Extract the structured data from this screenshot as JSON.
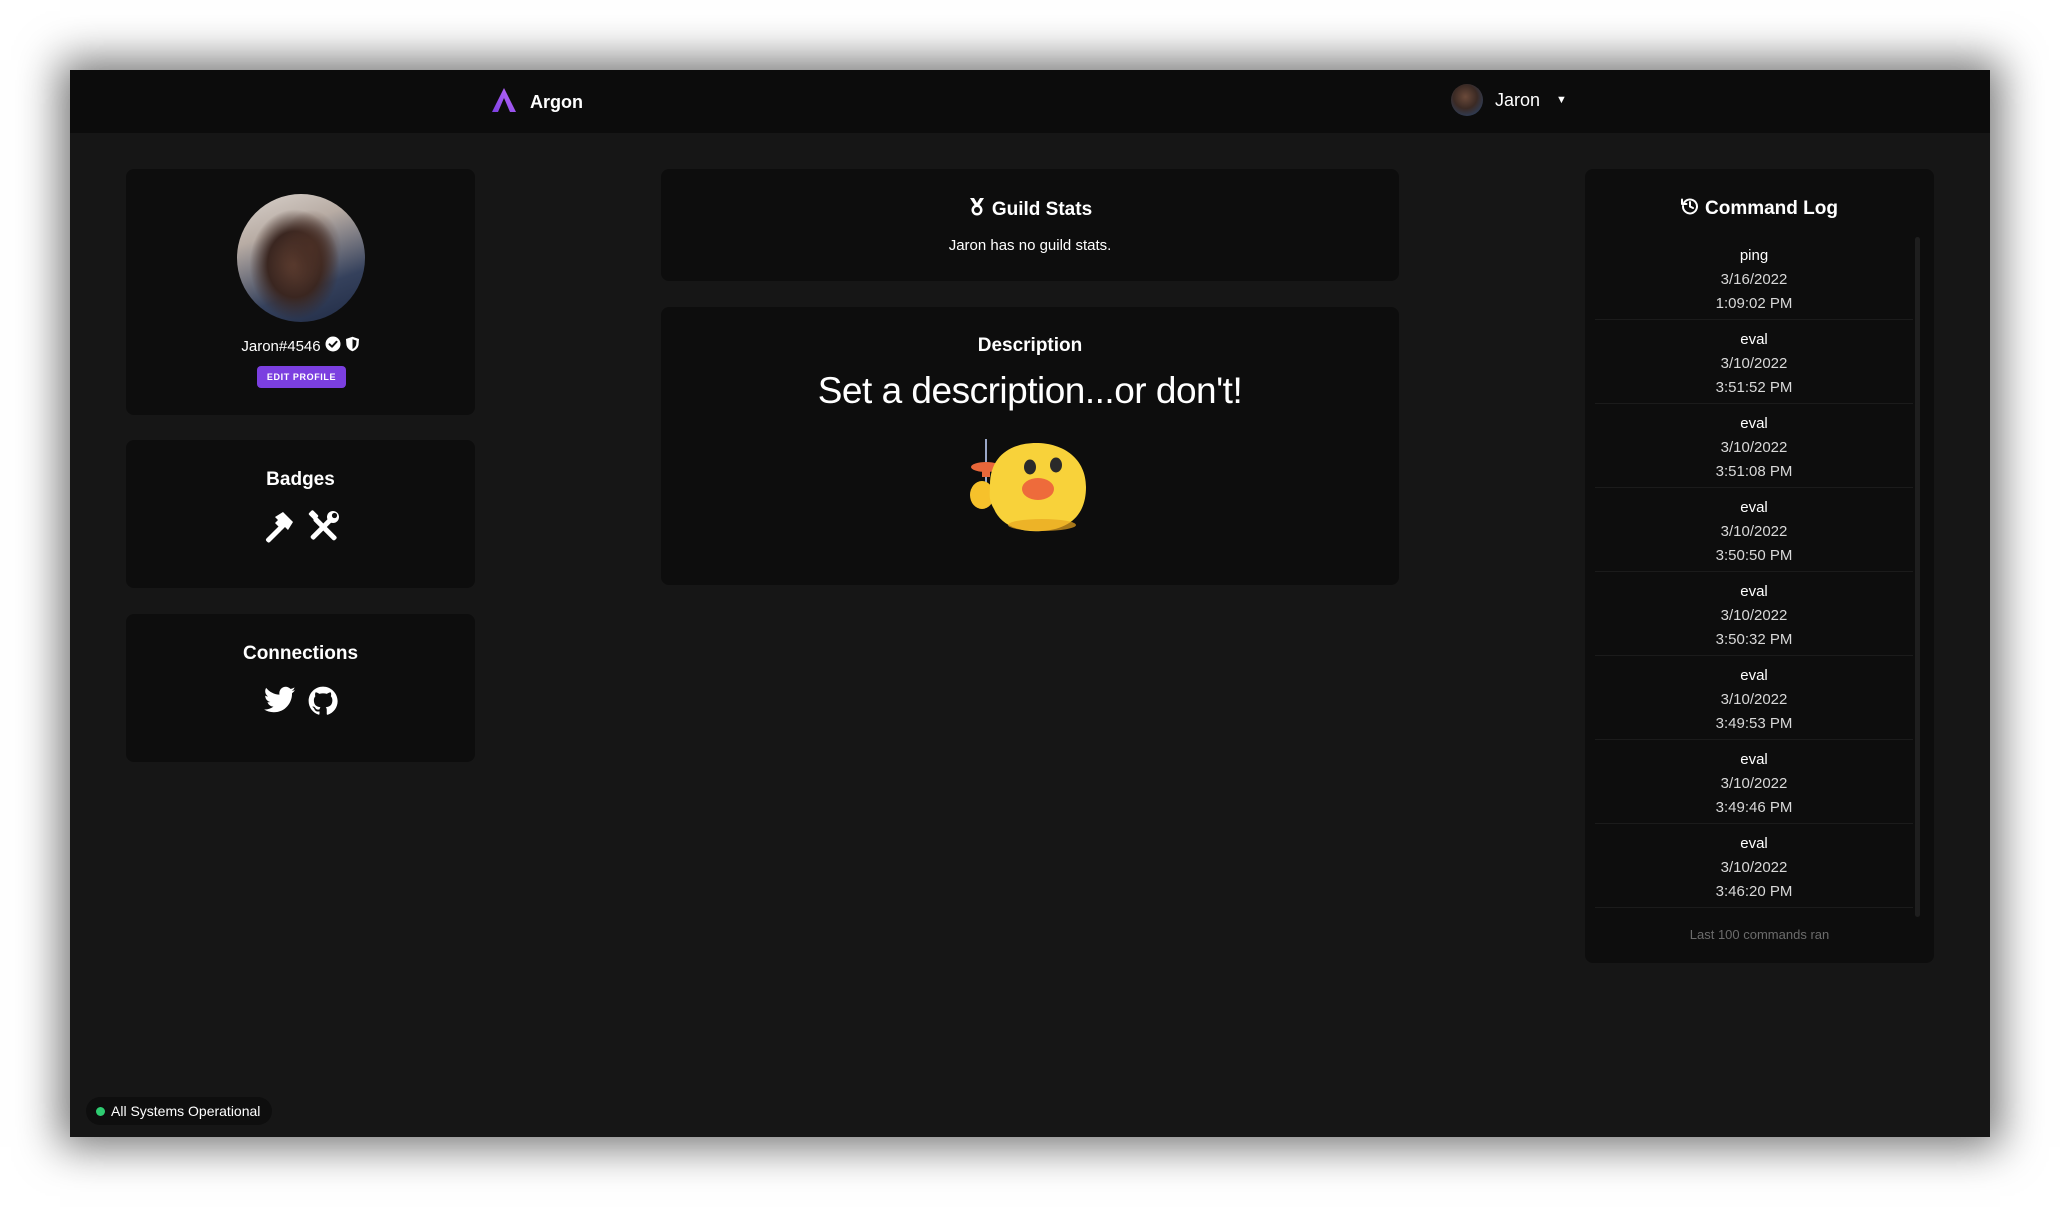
{
  "app": {
    "name": "Argon"
  },
  "user": {
    "name": "Jaron",
    "tag": "Jaron#4546"
  },
  "profile": {
    "edit_label": "EDIT PROFILE"
  },
  "badges": {
    "title": "Badges",
    "items": [
      "hammer-icon",
      "tools-icon"
    ]
  },
  "connections": {
    "title": "Connections",
    "items": [
      "twitter-icon",
      "github-icon"
    ]
  },
  "guild": {
    "title": "Guild Stats",
    "text": "Jaron has no guild stats."
  },
  "description": {
    "title": "Description",
    "text": "Set a description...or don't!",
    "emoji": "duck-with-pin-emoji"
  },
  "command_log": {
    "title": "Command Log",
    "entries": [
      {
        "name": "ping",
        "date": "3/16/2022",
        "time": "1:09:02 PM"
      },
      {
        "name": "eval",
        "date": "3/10/2022",
        "time": "3:51:52 PM"
      },
      {
        "name": "eval",
        "date": "3/10/2022",
        "time": "3:51:08 PM"
      },
      {
        "name": "eval",
        "date": "3/10/2022",
        "time": "3:50:50 PM"
      },
      {
        "name": "eval",
        "date": "3/10/2022",
        "time": "3:50:32 PM"
      },
      {
        "name": "eval",
        "date": "3/10/2022",
        "time": "3:49:53 PM"
      },
      {
        "name": "eval",
        "date": "3/10/2022",
        "time": "3:49:46 PM"
      },
      {
        "name": "eval",
        "date": "3/10/2022",
        "time": "3:46:20 PM"
      }
    ],
    "footer": "Last 100 commands ran"
  },
  "status": {
    "text": "All Systems Operational",
    "color": "#2ecc71"
  },
  "colors": {
    "background": "#161616",
    "card": "#0d0d0d",
    "accent": "#7b3fe0"
  }
}
